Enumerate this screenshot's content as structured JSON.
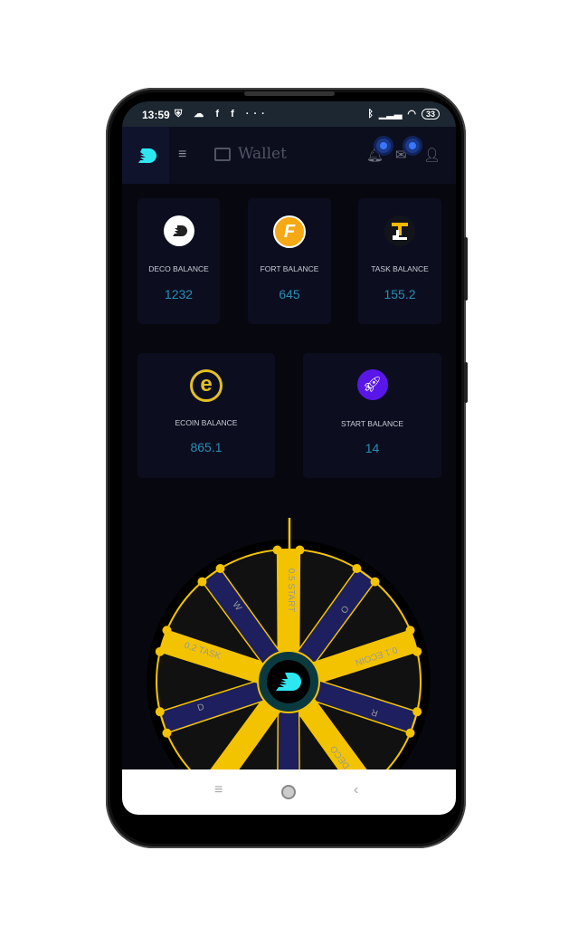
{
  "status_bar": {
    "time": "13:59",
    "battery": "33"
  },
  "header": {
    "title": "Wallet"
  },
  "balances": [
    {
      "label": "DECO BALANCE",
      "value": "1232",
      "icon": "deco-coin-icon",
      "color": "#ffffff"
    },
    {
      "label": "FORT BALANCE",
      "value": "645",
      "icon": "fort-coin-icon",
      "color": "#f5a914"
    },
    {
      "label": "TASK BALANCE",
      "value": "155.2",
      "icon": "task-coin-icon",
      "color": "#f5b800"
    },
    {
      "label": "ECOIN BALANCE",
      "value": "865.1",
      "icon": "ecoin-coin-icon",
      "color": "#e2c024"
    },
    {
      "label": "START BALANCE",
      "value": "14",
      "icon": "start-rocket-icon",
      "color": "#5a16e8"
    }
  ],
  "wheel": {
    "segments": [
      "0.5 START",
      "O",
      "0.1 ECOIN",
      "R",
      "DECO",
      "",
      "",
      "D",
      "0.2 TASK",
      "W"
    ]
  },
  "colors": {
    "accent": "#2a8db4",
    "wheel_yellow": "#f3c300",
    "wheel_navy": "#1d1f5e",
    "logo_cyan": "#2ee6f0"
  }
}
